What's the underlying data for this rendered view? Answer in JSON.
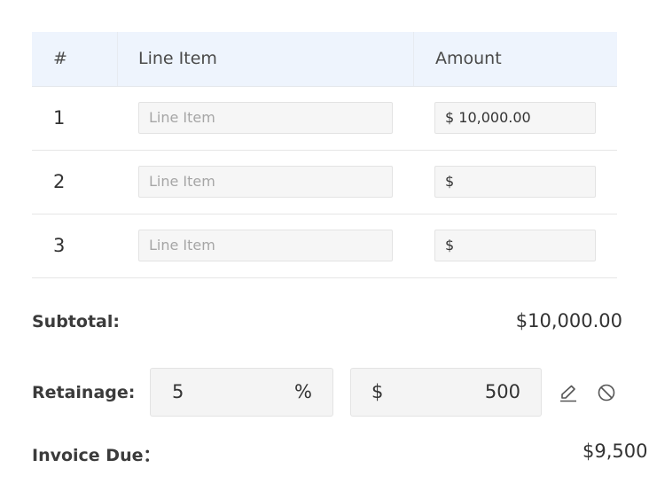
{
  "table": {
    "headers": {
      "number": "#",
      "line_item": "Line Item",
      "amount": "Amount"
    },
    "rows": [
      {
        "number": "1",
        "line_item_placeholder": "Line Item",
        "amount_value": "$  10,000.00"
      },
      {
        "number": "2",
        "line_item_placeholder": "Line Item",
        "amount_value": "$"
      },
      {
        "number": "3",
        "line_item_placeholder": "Line Item",
        "amount_value": "$"
      }
    ]
  },
  "subtotal": {
    "label": "Subtotal:",
    "value": "$10,000.00"
  },
  "retainage": {
    "label": "Retainage:",
    "percent_value": "5",
    "percent_symbol": "%",
    "currency_symbol": "$",
    "amount_value": "500",
    "icons": [
      "edit-icon",
      "cancel-icon"
    ]
  },
  "invoice_due": {
    "label": "Invoice Due：",
    "value": "$9,500"
  },
  "colors": {
    "header_bg": "#eef4fd",
    "input_bg": "#f6f6f6",
    "border": "#e3e3e3",
    "text": "#333333",
    "placeholder": "#a6a6a6"
  }
}
